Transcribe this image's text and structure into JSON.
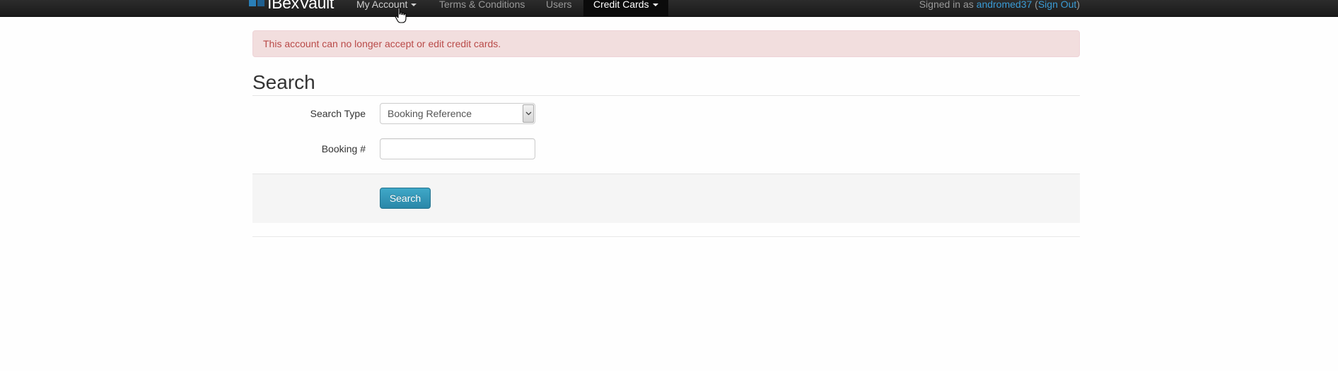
{
  "navbar": {
    "brand": "IBexVault",
    "brand_logo_colors": [
      "#2a7fb8",
      "#1f5f8f",
      "#3a9bd5"
    ],
    "items": [
      {
        "label": "My Account",
        "dropdown": true
      },
      {
        "label": "Terms & Conditions",
        "dropdown": false
      },
      {
        "label": "Users",
        "dropdown": false
      },
      {
        "label": "Credit Cards",
        "dropdown": true,
        "active": true
      }
    ],
    "signed_in": {
      "prefix": "Signed in as",
      "username": "andromed37",
      "open_paren": "(",
      "sign_out": "Sign Out",
      "close_paren": ")"
    }
  },
  "alert": {
    "text": "This account can no longer accept or edit credit cards."
  },
  "search": {
    "heading": "Search",
    "search_type_label": "Search Type",
    "search_type_value": "Booking Reference",
    "booking_label": "Booking #",
    "booking_value": "",
    "button_label": "Search"
  },
  "colors": {
    "navbar": "#1b1b1b",
    "link": "#3a9bd5",
    "alert_bg": "#f2dede",
    "alert_text": "#b94a48",
    "button": "#2f96b4"
  }
}
